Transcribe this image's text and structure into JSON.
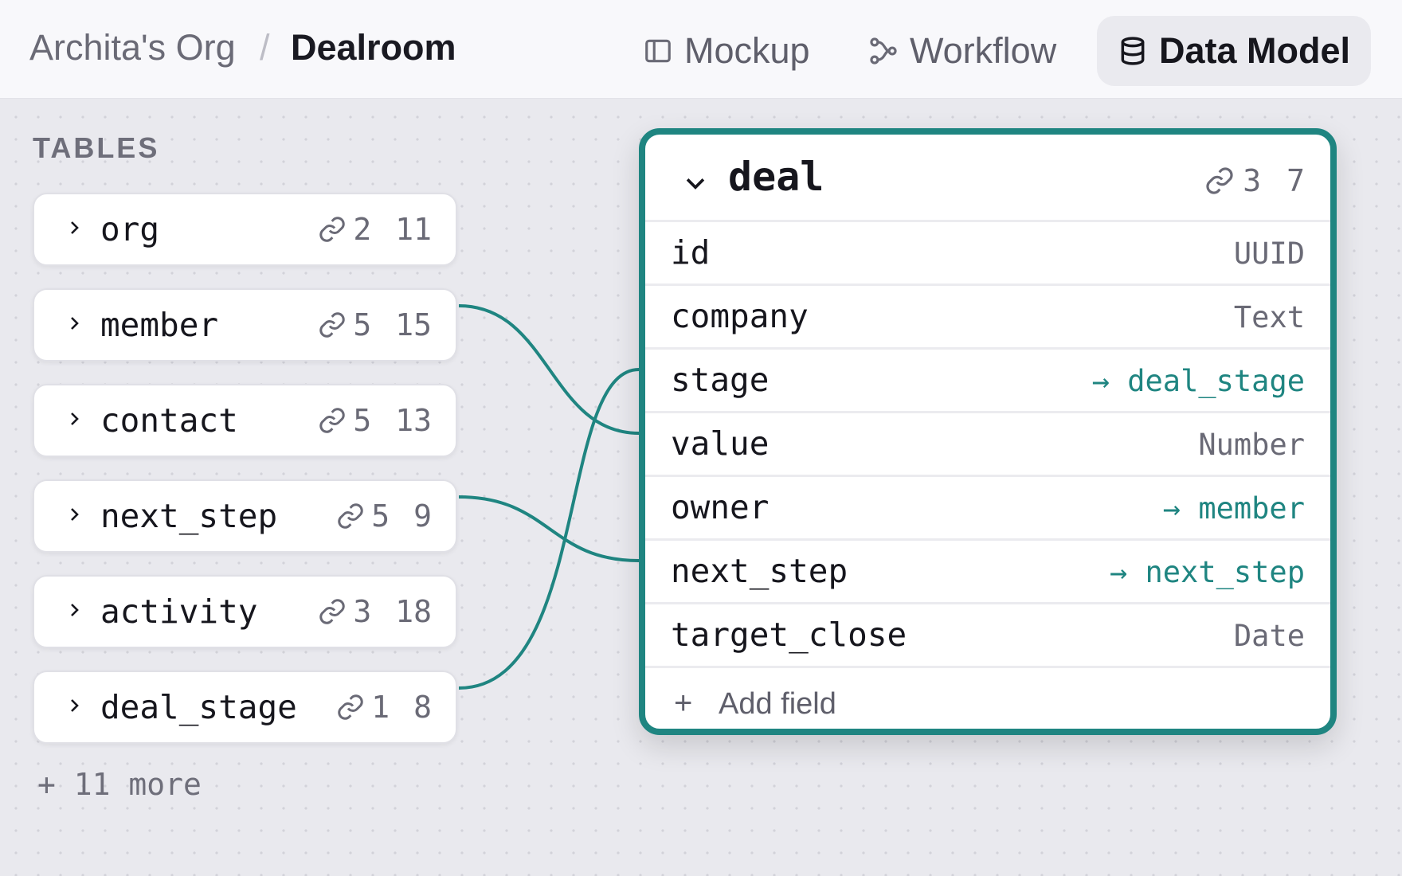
{
  "header": {
    "org": "Archita's Org",
    "separator": "/",
    "page": "Dealroom",
    "tabs": [
      {
        "label": "Mockup",
        "icon": "panel-icon",
        "active": false
      },
      {
        "label": "Workflow",
        "icon": "workflow-icon",
        "active": false
      },
      {
        "label": "Data Model",
        "icon": "database-icon",
        "active": true
      }
    ]
  },
  "sidebar": {
    "title": "TABLES",
    "tables": [
      {
        "name": "org",
        "links": "2",
        "fields": "11"
      },
      {
        "name": "member",
        "links": "5",
        "fields": "15"
      },
      {
        "name": "contact",
        "links": "5",
        "fields": "13"
      },
      {
        "name": "next_step",
        "links": "5",
        "fields": "9"
      },
      {
        "name": "activity",
        "links": "3",
        "fields": "18"
      },
      {
        "name": "deal_stage",
        "links": "1",
        "fields": "8"
      }
    ],
    "more": "+ 11 more"
  },
  "table_detail": {
    "name": "deal",
    "links": "3",
    "fields_count": "7",
    "fields": [
      {
        "name": "id",
        "type": "UUID"
      },
      {
        "name": "company",
        "type": "Text"
      },
      {
        "name": "stage",
        "type": "→ deal_stage"
      },
      {
        "name": "value",
        "type": "Number"
      },
      {
        "name": "owner",
        "type": "→ member"
      },
      {
        "name": "next_step",
        "type": "→ next_step"
      },
      {
        "name": "target_close",
        "type": "Date"
      }
    ],
    "add_field": "Add field",
    "add_icon": "+"
  },
  "colors": {
    "accent": "#1f8581",
    "canvas": "#e9e9ee",
    "card": "#ffffff"
  }
}
